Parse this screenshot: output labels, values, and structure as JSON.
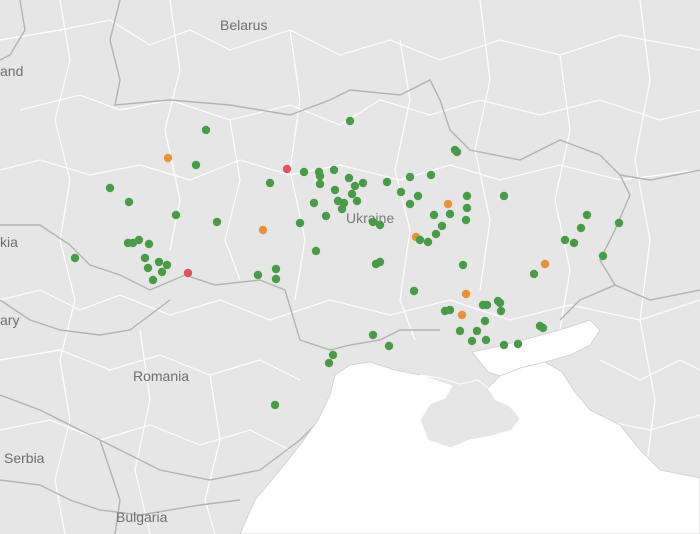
{
  "map": {
    "labels": {
      "belarus": "Belarus",
      "poland": "and",
      "slovakia": "kia",
      "hungary": "ary",
      "romania": "Romania",
      "ukraine": "Ukraine",
      "serbia": "Serbia",
      "bulgaria": "Bulgaria"
    },
    "colors": {
      "land": "#e6e6e6",
      "sea": "#ffffff",
      "country_border": "#b4b4b4",
      "region_border": "#ffffff",
      "green": "#4a9a4a",
      "orange": "#e8903a",
      "red": "#d9555f"
    },
    "markers": [
      {
        "status": "green"
      },
      {
        "status": "green"
      },
      {
        "status": "orange"
      },
      {
        "status": "green"
      },
      {
        "status": "green"
      },
      {
        "status": "green"
      },
      {
        "status": "green"
      },
      {
        "status": "green"
      },
      {
        "status": "green"
      },
      {
        "status": "green"
      },
      {
        "status": "green"
      },
      {
        "status": "green"
      },
      {
        "status": "green"
      },
      {
        "status": "green"
      },
      {
        "status": "green"
      },
      {
        "status": "green"
      },
      {
        "status": "green"
      },
      {
        "status": "red"
      },
      {
        "status": "green"
      },
      {
        "status": "green"
      },
      {
        "status": "orange"
      },
      {
        "status": "red"
      },
      {
        "status": "green"
      },
      {
        "status": "green"
      },
      {
        "status": "green"
      },
      {
        "status": "green"
      },
      {
        "status": "green"
      },
      {
        "status": "green"
      },
      {
        "status": "green"
      },
      {
        "status": "green"
      },
      {
        "status": "green"
      },
      {
        "status": "green"
      },
      {
        "status": "green"
      },
      {
        "status": "green"
      },
      {
        "status": "green"
      },
      {
        "status": "green"
      },
      {
        "status": "green"
      },
      {
        "status": "green"
      },
      {
        "status": "green"
      },
      {
        "status": "green"
      },
      {
        "status": "green"
      },
      {
        "status": "green"
      },
      {
        "status": "green"
      },
      {
        "status": "green"
      },
      {
        "status": "green"
      },
      {
        "status": "green"
      },
      {
        "status": "green"
      },
      {
        "status": "green"
      },
      {
        "status": "green"
      },
      {
        "status": "green"
      },
      {
        "status": "green"
      },
      {
        "status": "orange"
      },
      {
        "status": "green"
      },
      {
        "status": "orange"
      },
      {
        "status": "green"
      },
      {
        "status": "green"
      },
      {
        "status": "green"
      },
      {
        "status": "green"
      },
      {
        "status": "green"
      },
      {
        "status": "green"
      },
      {
        "status": "green"
      },
      {
        "status": "green"
      },
      {
        "status": "green"
      },
      {
        "status": "green"
      },
      {
        "status": "green"
      },
      {
        "status": "green"
      },
      {
        "status": "green"
      },
      {
        "status": "orange"
      },
      {
        "status": "green"
      },
      {
        "status": "green"
      },
      {
        "status": "orange"
      },
      {
        "status": "green"
      },
      {
        "status": "green"
      },
      {
        "status": "green"
      },
      {
        "status": "orange"
      },
      {
        "status": "green"
      },
      {
        "status": "green"
      },
      {
        "status": "green"
      },
      {
        "status": "green"
      },
      {
        "status": "green"
      },
      {
        "status": "green"
      },
      {
        "status": "green"
      },
      {
        "status": "green"
      },
      {
        "status": "green"
      },
      {
        "status": "green"
      },
      {
        "status": "green"
      },
      {
        "status": "green"
      },
      {
        "status": "green"
      },
      {
        "status": "green"
      },
      {
        "status": "green"
      },
      {
        "status": "green"
      },
      {
        "status": "green"
      },
      {
        "status": "green"
      },
      {
        "status": "green"
      },
      {
        "status": "green"
      },
      {
        "status": "green"
      },
      {
        "status": "green"
      },
      {
        "status": "green"
      },
      {
        "status": "green"
      },
      {
        "status": "green"
      },
      {
        "status": "green"
      }
    ]
  }
}
